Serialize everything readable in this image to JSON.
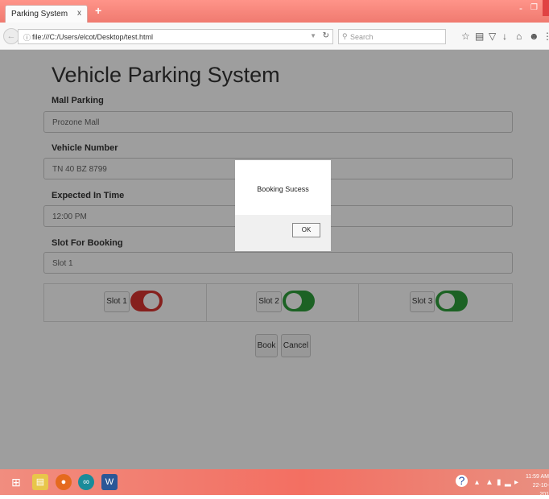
{
  "browser": {
    "tab_title": "Parking System",
    "tab_close": "x",
    "new_tab": "+",
    "url": "file:///C:/Users/elcot/Desktop/test.html",
    "search_placeholder": "Search",
    "window_min": "-",
    "window_max": "❐",
    "toolbar_icons": [
      "star-icon",
      "reading-list-icon",
      "pocket-icon",
      "download-icon",
      "home-icon",
      "chat-icon",
      "menu-icon"
    ]
  },
  "page": {
    "heading": "Vehicle Parking System",
    "mall_label": "Mall Parking",
    "mall_value": "Prozone Mall",
    "vehicle_label": "Vehicle Number",
    "vehicle_value": "TN 40 BZ 8799",
    "time_label": "Expected In Time",
    "time_value": "12:00 PM",
    "slot_label": "Slot For Booking",
    "slot_value": "Slot 1",
    "slots": [
      {
        "label": "Slot 1",
        "state": "occupied",
        "color": "#d9342f"
      },
      {
        "label": "Slot 2",
        "state": "available",
        "color": "#2e9f3a"
      },
      {
        "label": "Slot 3",
        "state": "available",
        "color": "#2e9f3a"
      }
    ],
    "book_label": "Book",
    "cancel_label": "Cancel"
  },
  "dialog": {
    "message": "Booking Sucess",
    "ok_label": "OK"
  },
  "taskbar": {
    "clock_time": "11:59 AM",
    "clock_date": "22-10-201"
  },
  "colors": {
    "titlebar": "#f07a70",
    "taskbar": "#f36f62",
    "occupied": "#d9342f",
    "available": "#2e9f3a"
  }
}
